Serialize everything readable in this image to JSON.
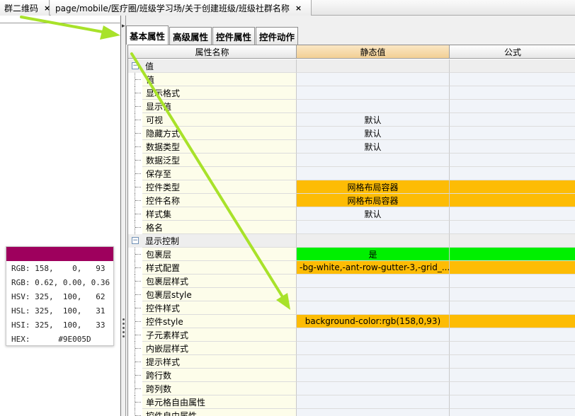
{
  "doc_tabs": [
    {
      "label": "群二维码",
      "close": "×"
    },
    {
      "label": "page/mobile/医疗圈/班级学习场/关于创建班级/班级社群名称",
      "close": "×"
    }
  ],
  "color_info": {
    "swatch": "#9E005D",
    "rows": [
      "RGB: 158,    0,   93",
      "RGB: 0.62, 0.00, 0.36",
      "HSV: 325,  100,   62",
      "HSL: 325,  100,   31",
      "HSI: 325,  100,   33",
      "HEX:      #9E005D"
    ]
  },
  "property_tabs": [
    "基本属性",
    "高级属性",
    "控件属性",
    "控件动作"
  ],
  "columns": {
    "name": "属性名称",
    "static": "静态值",
    "formula": "公式"
  },
  "rows": [
    {
      "name": "值",
      "value": "",
      "group": true,
      "expander": "−"
    },
    {
      "name": "值",
      "value": ""
    },
    {
      "name": "显示格式",
      "value": ""
    },
    {
      "name": "显示值",
      "value": ""
    },
    {
      "name": "可视",
      "value": "默认"
    },
    {
      "name": "隐藏方式",
      "value": "默认"
    },
    {
      "name": "数据类型",
      "value": "默认"
    },
    {
      "name": "数据泛型",
      "value": ""
    },
    {
      "name": "保存至",
      "value": ""
    },
    {
      "name": "控件类型",
      "value": "网格布局容器",
      "highlight": "orange"
    },
    {
      "name": "控件名称",
      "value": "网格布局容器",
      "highlight": "orange"
    },
    {
      "name": "样式集",
      "value": "默认"
    },
    {
      "name": "格名",
      "value": ""
    },
    {
      "name": "显示控制",
      "value": "",
      "group": true,
      "expander": "−"
    },
    {
      "name": "包裹层",
      "value": "是",
      "highlight": "green"
    },
    {
      "name": "样式配置",
      "value": "-bg-white,-ant-row-gutter-3,-grid_...",
      "highlight": "orange",
      "align": "left"
    },
    {
      "name": "包裹层样式",
      "value": ""
    },
    {
      "name": "包裹层style",
      "value": ""
    },
    {
      "name": "控件样式",
      "value": ""
    },
    {
      "name": "控件style",
      "value": "background-color:rgb(158,0,93)",
      "highlight": "orange"
    },
    {
      "name": "子元素样式",
      "value": ""
    },
    {
      "name": "内嵌层样式",
      "value": ""
    },
    {
      "name": "提示样式",
      "value": ""
    },
    {
      "name": "跨行数",
      "value": ""
    },
    {
      "name": "跨列数",
      "value": ""
    },
    {
      "name": "单元格自由属性",
      "value": ""
    },
    {
      "name": "控件自由属性",
      "value": ""
    }
  ],
  "colors": {
    "orange": "#FDBC05",
    "green": "#00F000",
    "annotation_arrow": "#A8E22A"
  }
}
